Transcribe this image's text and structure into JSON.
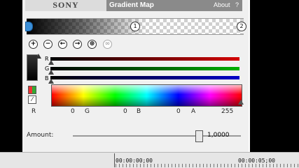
{
  "header": {
    "logo_text": "SONY",
    "title": "Gradient Map",
    "about": "About",
    "help": "?"
  },
  "gradient": {
    "stops": [
      "1",
      "2"
    ]
  },
  "toolbar": {
    "icons": [
      {
        "name": "add-stop-icon",
        "glyph": "+"
      },
      {
        "name": "remove-stop-icon",
        "glyph": "−"
      },
      {
        "name": "move-left-icon",
        "glyph": "←"
      },
      {
        "name": "move-right-icon",
        "glyph": "→"
      },
      {
        "name": "center-icon",
        "glyph": "⊕"
      },
      {
        "name": "link-icon",
        "glyph": "∞"
      }
    ]
  },
  "channels": {
    "r_label": "R",
    "g_label": "G",
    "b_label": "B",
    "r_color": "#d40000",
    "g_color": "#00b000",
    "b_color": "#0000c8"
  },
  "values": {
    "r_label": "R",
    "r_value": "0",
    "g_label": "G",
    "g_value": "0",
    "b_label": "B",
    "b_value": "0",
    "a_label": "A",
    "a_value": "255"
  },
  "amount": {
    "label": "Amount:",
    "value": "1,0000",
    "fraction": 0.75
  },
  "timeline": {
    "timecode_start": "00:00:00;00",
    "timecode_end": "00:00:05;00"
  }
}
